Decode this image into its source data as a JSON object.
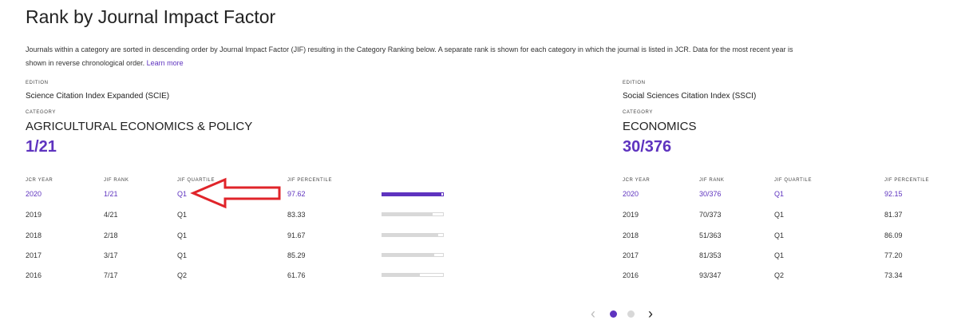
{
  "title": "Rank by Journal Impact Factor",
  "description": {
    "line1": "Journals within a category are sorted in descending order by Journal Impact Factor (JIF) resulting in the Category Ranking below. A separate rank is shown for each category in which the journal is listed in JCR. Data for the most recent year is",
    "line2": "shown in reverse chronological order.",
    "link": "Learn more"
  },
  "colors": {
    "accent": "#5e33bf",
    "arrow": "#e0242a"
  },
  "left": {
    "edition_label": "EDITION",
    "edition": "Science Citation Index Expanded (SCIE)",
    "category_label": "CATEGORY",
    "category": "AGRICULTURAL ECONOMICS & POLICY",
    "rank": "1/21",
    "headers": [
      "JCR YEAR",
      "JIF RANK",
      "JIF QUARTILE",
      "JIF PERCENTILE"
    ],
    "rows": [
      {
        "year": "2020",
        "rank": "1/21",
        "quartile": "Q1",
        "percentile": "97.62"
      },
      {
        "year": "2019",
        "rank": "4/21",
        "quartile": "Q1",
        "percentile": "83.33"
      },
      {
        "year": "2018",
        "rank": "2/18",
        "quartile": "Q1",
        "percentile": "91.67"
      },
      {
        "year": "2017",
        "rank": "3/17",
        "quartile": "Q1",
        "percentile": "85.29"
      },
      {
        "year": "2016",
        "rank": "7/17",
        "quartile": "Q2",
        "percentile": "61.76"
      }
    ]
  },
  "right": {
    "edition_label": "EDITION",
    "edition": "Social Sciences Citation Index (SSCI)",
    "category_label": "CATEGORY",
    "category": "ECONOMICS",
    "rank": "30/376",
    "headers": [
      "JCR YEAR",
      "JIF RANK",
      "JIF QUARTILE",
      "JIF PERCENTILE"
    ],
    "rows": [
      {
        "year": "2020",
        "rank": "30/376",
        "quartile": "Q1",
        "percentile": "92.15"
      },
      {
        "year": "2019",
        "rank": "70/373",
        "quartile": "Q1",
        "percentile": "81.37"
      },
      {
        "year": "2018",
        "rank": "51/363",
        "quartile": "Q1",
        "percentile": "86.09"
      },
      {
        "year": "2017",
        "rank": "81/353",
        "quartile": "Q1",
        "percentile": "77.20"
      },
      {
        "year": "2016",
        "rank": "93/347",
        "quartile": "Q2",
        "percentile": "73.34"
      }
    ]
  },
  "pager": {
    "prev_icon": "chevron-left-icon",
    "next_icon": "chevron-right-icon",
    "pages": 2,
    "current": 1
  }
}
